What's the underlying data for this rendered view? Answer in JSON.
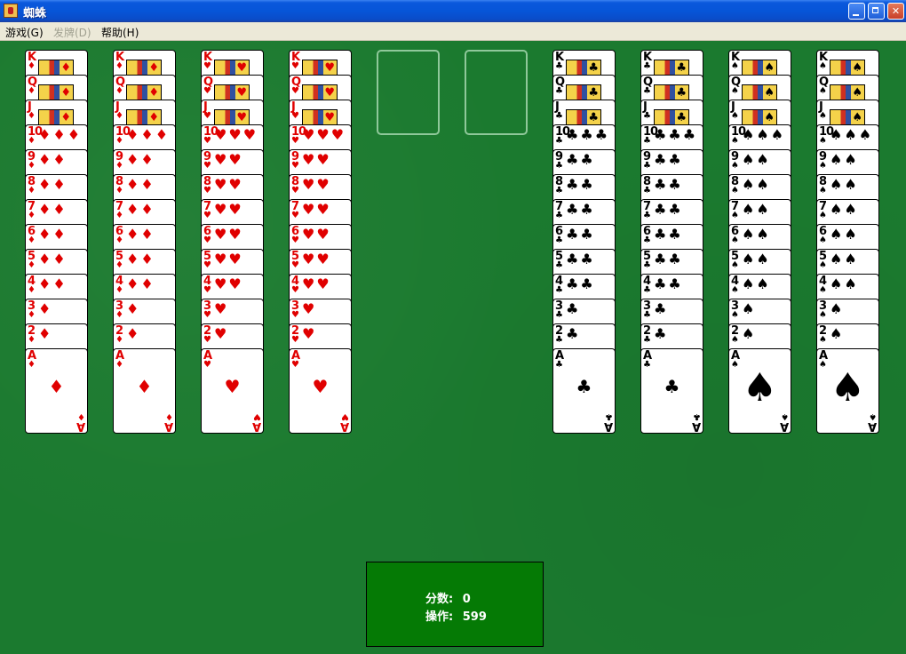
{
  "window": {
    "title": "蜘蛛"
  },
  "menu": [
    {
      "label": "游戏(G)",
      "enabled": true
    },
    {
      "label": "发牌(D)",
      "enabled": false
    },
    {
      "label": "帮助(H)",
      "enabled": true
    }
  ],
  "columns": [
    {
      "suit": "diamond",
      "symbol": "♦",
      "color": "#e00000",
      "cards": [
        "K",
        "Q",
        "J",
        "10",
        "9",
        "8",
        "7",
        "6",
        "5",
        "4",
        "3",
        "2",
        "A"
      ]
    },
    {
      "suit": "diamond",
      "symbol": "♦",
      "color": "#e00000",
      "cards": [
        "K",
        "Q",
        "J",
        "10",
        "9",
        "8",
        "7",
        "6",
        "5",
        "4",
        "3",
        "2",
        "A"
      ]
    },
    {
      "suit": "heart",
      "symbol": "♥",
      "color": "#e00000",
      "cards": [
        "K",
        "Q",
        "J",
        "10",
        "9",
        "8",
        "7",
        "6",
        "5",
        "4",
        "3",
        "2",
        "A"
      ]
    },
    {
      "suit": "heart",
      "symbol": "♥",
      "color": "#e00000",
      "cards": [
        "K",
        "Q",
        "J",
        "10",
        "9",
        "8",
        "7",
        "6",
        "5",
        "4",
        "3",
        "2",
        "A"
      ]
    },
    {
      "empty": true
    },
    {
      "empty": true
    },
    {
      "suit": "club",
      "symbol": "♣",
      "color": "#000000",
      "cards": [
        "K",
        "Q",
        "J",
        "10",
        "9",
        "8",
        "7",
        "6",
        "5",
        "4",
        "3",
        "2",
        "A"
      ]
    },
    {
      "suit": "club",
      "symbol": "♣",
      "color": "#000000",
      "cards": [
        "K",
        "Q",
        "J",
        "10",
        "9",
        "8",
        "7",
        "6",
        "5",
        "4",
        "3",
        "2",
        "A"
      ]
    },
    {
      "suit": "spade",
      "symbol": "♠",
      "color": "#000000",
      "cards": [
        "K",
        "Q",
        "J",
        "10",
        "9",
        "8",
        "7",
        "6",
        "5",
        "4",
        "3",
        "2",
        "A"
      ]
    },
    {
      "suit": "spade",
      "symbol": "♠",
      "color": "#000000",
      "cards": [
        "K",
        "Q",
        "J",
        "10",
        "9",
        "8",
        "7",
        "6",
        "5",
        "4",
        "3",
        "2",
        "A"
      ]
    }
  ],
  "score": {
    "score_label": "分数:",
    "score_value": "0",
    "moves_label": "操作:",
    "moves_value": "599"
  }
}
